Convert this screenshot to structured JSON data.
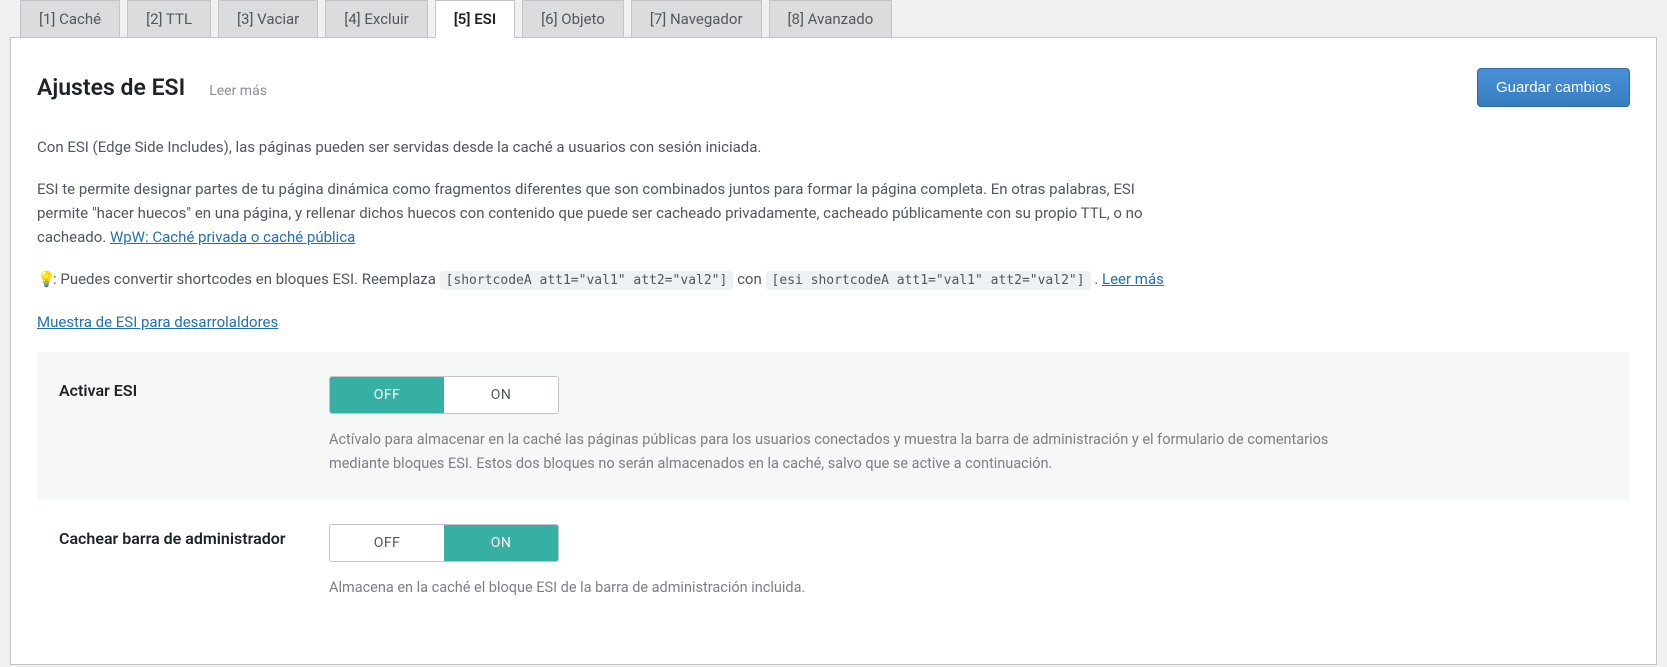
{
  "tabs": [
    {
      "label": "[1] Caché"
    },
    {
      "label": "[2] TTL"
    },
    {
      "label": "[3] Vaciar"
    },
    {
      "label": "[4] Excluir"
    },
    {
      "label": "[5] ESI"
    },
    {
      "label": "[6] Objeto"
    },
    {
      "label": "[7] Navegador"
    },
    {
      "label": "[8] Avanzado"
    }
  ],
  "header": {
    "title": "Ajustes de ESI",
    "learn_more": "Leer más",
    "save_btn": "Guardar cambios"
  },
  "desc": {
    "p1": "Con ESI (Edge Side Includes), las páginas pueden ser servidas desde la caché a usuarios con sesión iniciada.",
    "p2a": "ESI te permite designar partes de tu página dinámica como fragmentos diferentes que son combinados juntos para formar la página completa. En otras palabras, ESI permite \"hacer huecos\" en una página, y rellenar dichos huecos con contenido que puede ser cacheado privadamente, cacheado públicamente con su propio TTL, o no cacheado. ",
    "p2_link": "WpW: Caché privada o caché pública",
    "p3a": ": Puedes convertir shortcodes en bloques ESI. Reemplaza ",
    "p3_code1": "[shortcodeA att1=\"val1\" att2=\"val2\"]",
    "p3b": " con ",
    "p3_code2": "[esi shortcodeA att1=\"val1\" att2=\"val2\"]",
    "p3c": " . ",
    "p3_link": "Leer más",
    "p4_link": "Muestra de ESI para desarrolaldores"
  },
  "toggle": {
    "off": "OFF",
    "on": "ON"
  },
  "settings": {
    "enable_esi": {
      "label": "Activar ESI",
      "desc": "Actívalo para almacenar en la caché las páginas públicas para los usuarios conectados y muestra la barra de administración y el formulario de comentarios mediante bloques ESI. Estos dos bloques no serán almacenados en la caché, salvo que se active a continuación."
    },
    "cache_admin": {
      "label": "Cachear barra de administrador",
      "desc": "Almacena en la caché el bloque ESI de la barra de administración incluida."
    }
  }
}
